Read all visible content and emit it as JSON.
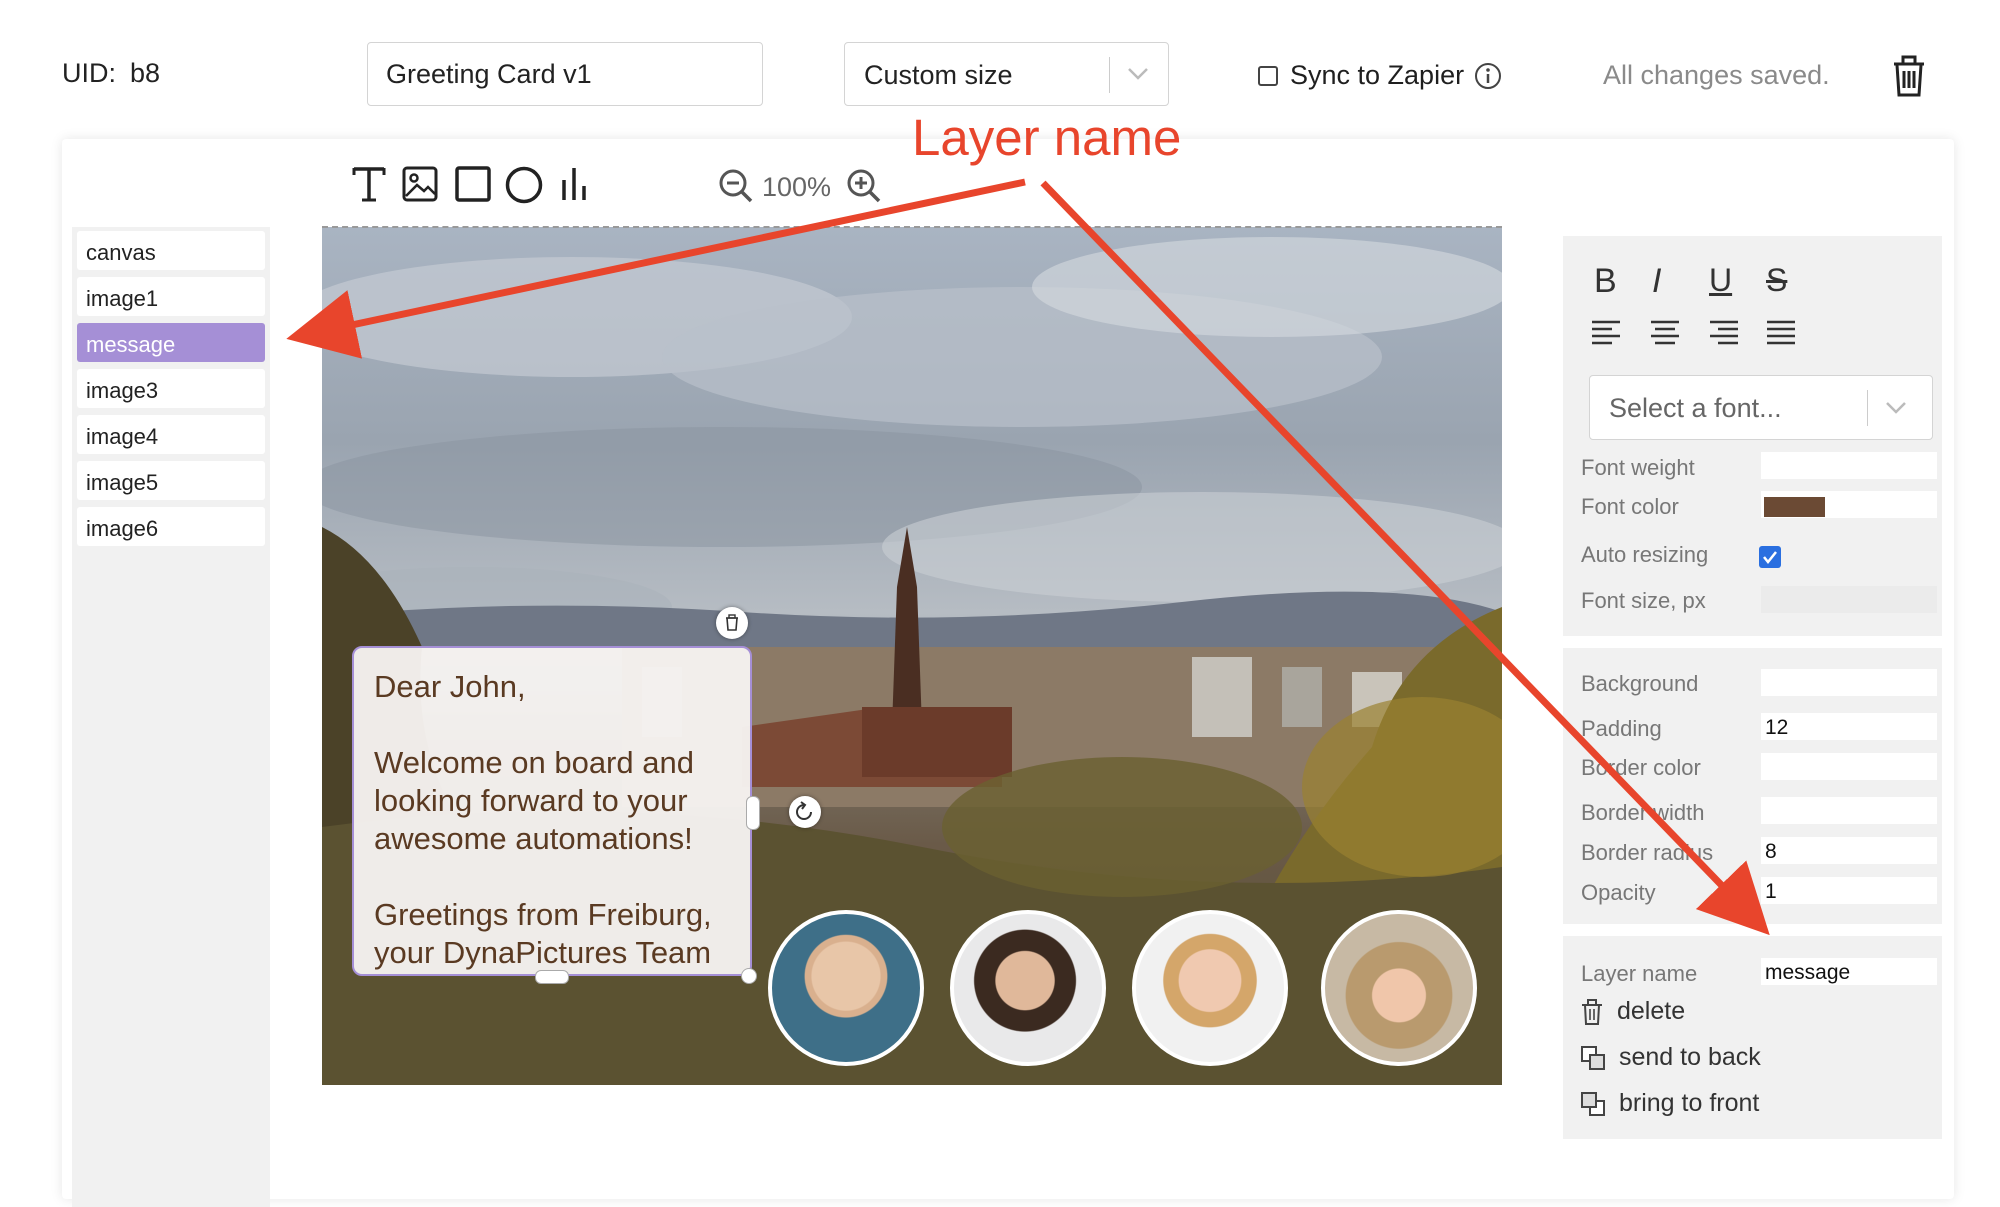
{
  "header": {
    "uid_label": "UID:",
    "uid_value": "b8",
    "name_value": "Greeting Card v1",
    "size_select": "Custom size",
    "sync_label": "Sync to Zapier",
    "status": "All changes saved."
  },
  "toolbar": {
    "tools": [
      "text-tool-icon",
      "image-tool-icon",
      "rectangle-tool-icon",
      "circle-tool-icon",
      "chart-tool-icon"
    ],
    "zoom": "100%"
  },
  "layers": [
    "canvas",
    "image1",
    "message",
    "image3",
    "image4",
    "image5",
    "image6"
  ],
  "selected_layer": "message",
  "canvas": {
    "message_lines": [
      "Dear John,",
      "Welcome on board and",
      "looking forward to your",
      "awesome automations!",
      "Greetings from Freiburg,",
      "your DynaPictures Team"
    ]
  },
  "text_props": {
    "font_placeholder": "Select a font...",
    "font_weight_label": "Font weight",
    "font_color_label": "Font color",
    "font_color_value": "#6b4a34",
    "auto_resizing_label": "Auto resizing",
    "auto_resizing_checked": true,
    "font_size_label": "Font size, px"
  },
  "box_props": {
    "background_label": "Background",
    "padding_label": "Padding",
    "padding_value": "12",
    "border_color_label": "Border color",
    "border_width_label": "Border width",
    "border_radius_label": "Border radius",
    "border_radius_value": "8",
    "opacity_label": "Opacity",
    "opacity_value": "1"
  },
  "layer_props": {
    "layer_name_label": "Layer name",
    "layer_name_value": "message",
    "delete_label": "delete",
    "send_back_label": "send to back",
    "bring_front_label": "bring to front"
  },
  "annotation": {
    "label": "Layer name",
    "color": "#e8452c"
  },
  "colors": {
    "selected_layer": "#a58fd6",
    "checkbox": "#2a6fe0"
  }
}
